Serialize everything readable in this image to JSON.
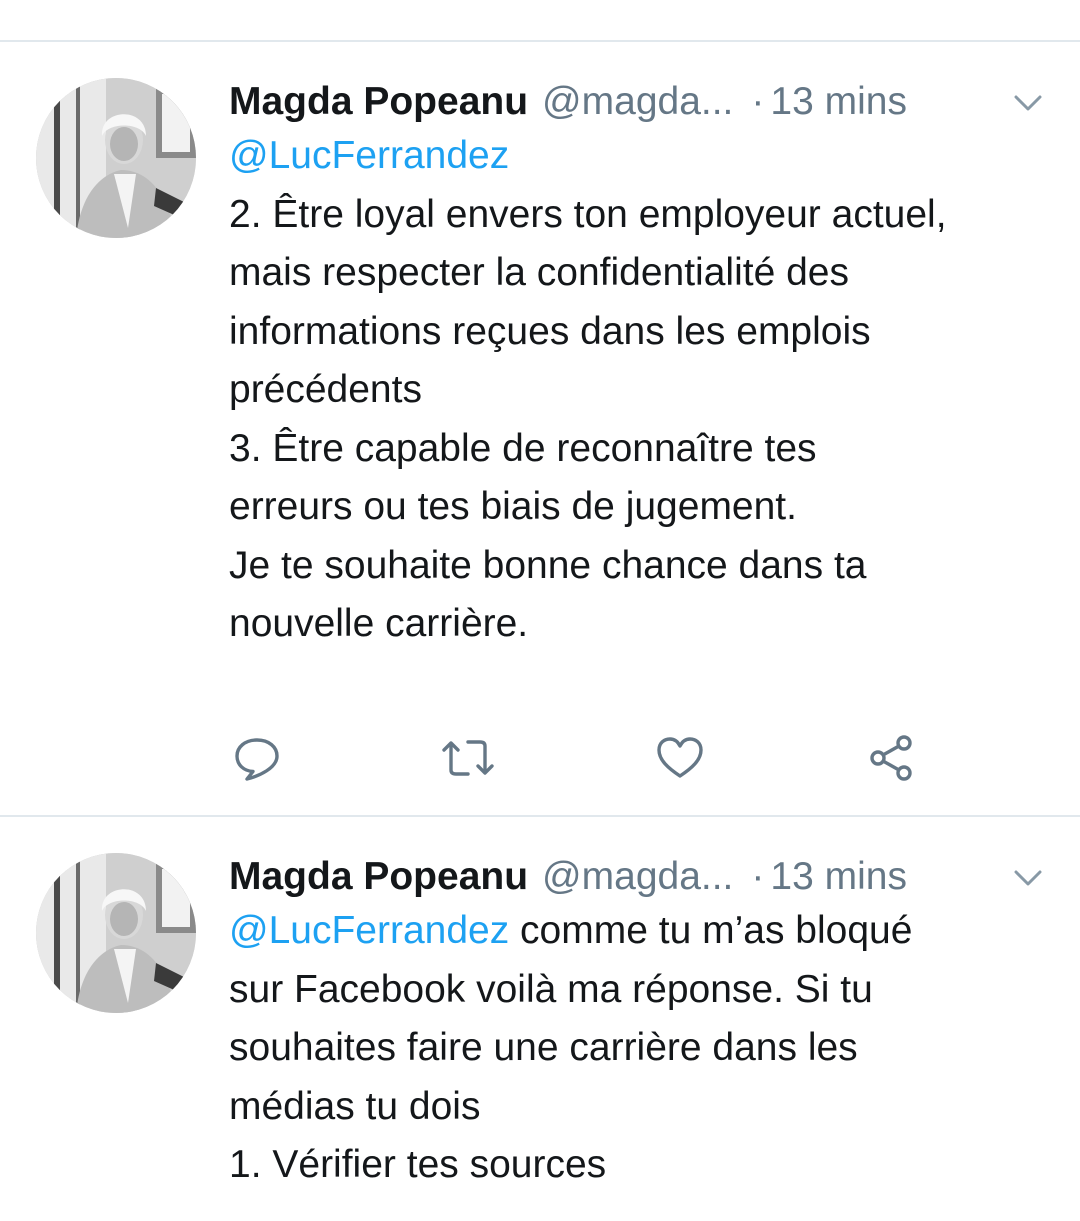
{
  "tweets": [
    {
      "author_name": "Magda Popeanu",
      "author_handle": "@magda...",
      "separator": "·",
      "time": "13 mins",
      "lines": [
        {
          "mention": "@LucFerrandez",
          "text": ""
        },
        {
          "mention": "",
          "text": "2. Être loyal envers ton employeur actuel,"
        },
        {
          "mention": "",
          "text": "mais respecter la confidentialité des"
        },
        {
          "mention": "",
          "text": "informations reçues dans les emplois"
        },
        {
          "mention": "",
          "text": "précédents"
        },
        {
          "mention": "",
          "text": "3. Être capable de reconnaître tes"
        },
        {
          "mention": "",
          "text": "erreurs ou tes biais de jugement."
        },
        {
          "mention": "",
          "text": "Je te souhaite bonne chance dans ta"
        },
        {
          "mention": "",
          "text": "nouvelle carrière."
        }
      ],
      "actions": [
        "reply-icon",
        "retweet-icon",
        "like-icon",
        "share-icon"
      ]
    },
    {
      "author_name": "Magda Popeanu",
      "author_handle": "@magda...",
      "separator": "·",
      "time": "13 mins",
      "lines": [
        {
          "mention": "@LucFerrandez",
          "text": " comme tu m’as bloqué"
        },
        {
          "mention": "",
          "text": "sur Facebook voilà ma réponse. Si tu"
        },
        {
          "mention": "",
          "text": "souhaites faire une carrière dans les"
        },
        {
          "mention": "",
          "text": "médias tu dois"
        },
        {
          "mention": "",
          "text": "1. Vérifier tes sources"
        }
      ]
    }
  ],
  "colors": {
    "mention": "#1da1f2",
    "secondary_text": "#657786",
    "primary_text": "#14171a",
    "divider": "#e1e8ed"
  }
}
